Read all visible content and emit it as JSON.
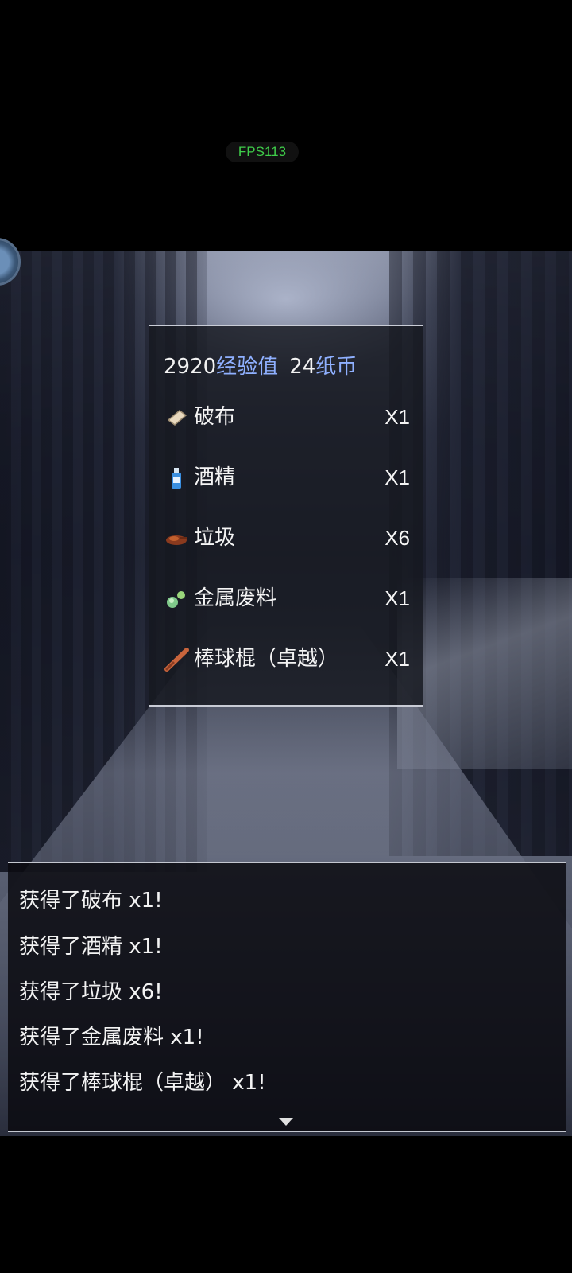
{
  "status": {
    "fps_label": "FPS113",
    "fps_color": "#3fce4a"
  },
  "rewards": {
    "exp_value": "2920",
    "exp_unit": "经验值",
    "coin_value": "24",
    "coin_unit": "纸币",
    "unit_color": "#8fb0ff",
    "items": [
      {
        "name": "破布",
        "count": "X1",
        "icon": "cloth-icon"
      },
      {
        "name": "酒精",
        "count": "X1",
        "icon": "alcohol-bottle-icon"
      },
      {
        "name": "垃圾",
        "count": "X6",
        "icon": "garbage-icon"
      },
      {
        "name": "金属废料",
        "count": "X1",
        "icon": "metal-scrap-icon"
      },
      {
        "name": "棒球棍（卓越）",
        "count": "X1",
        "icon": "baseball-bat-icon"
      }
    ]
  },
  "log": {
    "lines": [
      "获得了破布 x1!",
      "获得了酒精 x1!",
      "获得了垃圾 x6!",
      "获得了金属废料 x1!",
      "获得了棒球棍（卓越） x1!"
    ]
  }
}
